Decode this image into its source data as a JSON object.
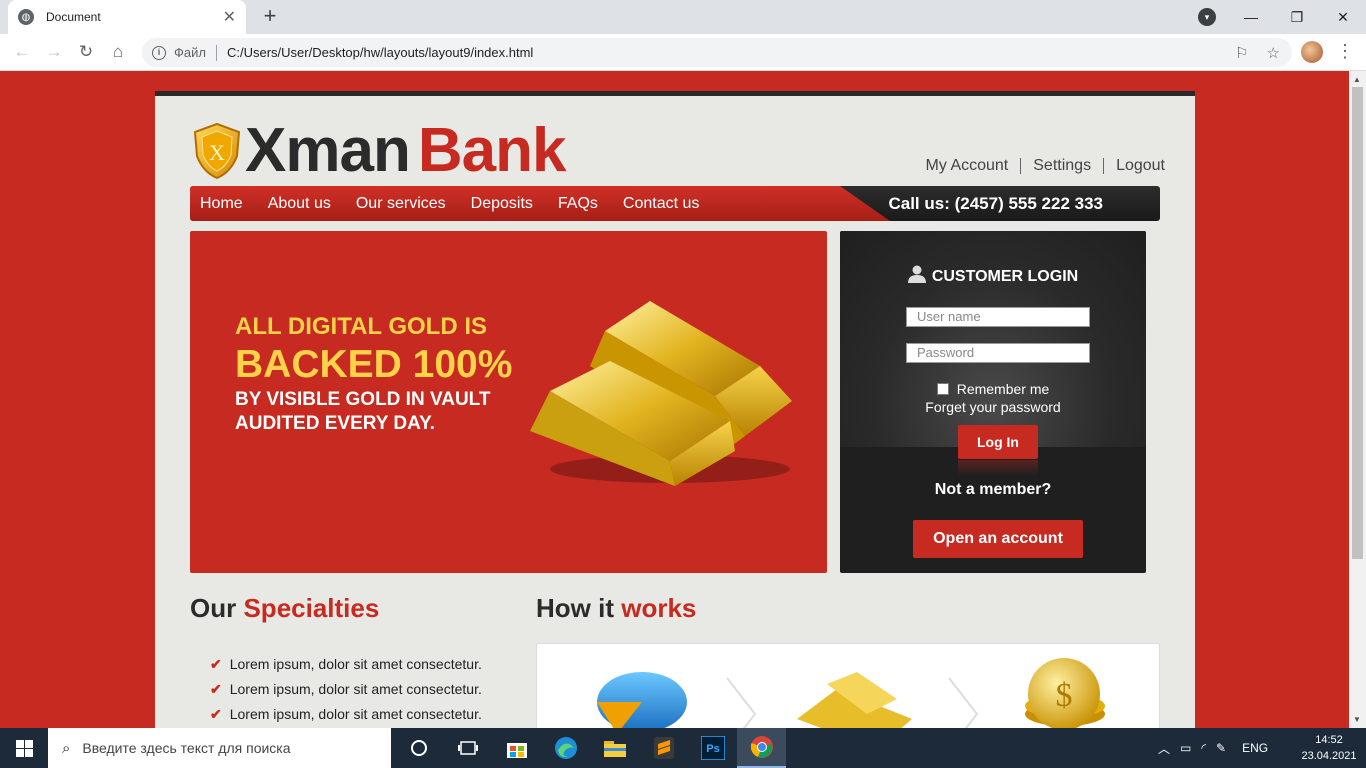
{
  "browser": {
    "tab_title": "Document",
    "address_file_label": "Файл",
    "address_url": "C:/Users/User/Desktop/hw/layouts/layout9/index.html"
  },
  "site": {
    "logo_part1": "Xman",
    "logo_part2": "Bank",
    "shield_letter": "X",
    "top_links": [
      "My Account",
      "Settings",
      "Logout"
    ],
    "nav": [
      "Home",
      "About us",
      "Our services",
      "Deposits",
      "FAQs",
      "Contact us"
    ],
    "call_us": "Call us: (2457) 555 222 333",
    "hero": {
      "line1": "ALL DIGITAL GOLD IS",
      "line2": "BACKED 100%",
      "line3": "BY VISIBLE GOLD IN VAULT",
      "line4": "AUDITED EVERY DAY."
    },
    "login": {
      "title": "CUSTOMER LOGIN",
      "username_placeholder": "User name",
      "password_placeholder": "Password",
      "remember": "Remember me",
      "forget": "Forget your password",
      "button": "Log In",
      "not_member": "Not a member?",
      "open_account": "Open an account"
    },
    "specialties": {
      "title_part1": "Our",
      "title_part2": "Specialties",
      "items": [
        "Lorem ipsum, dolor sit amet consectetur.",
        "Lorem ipsum, dolor sit amet consectetur.",
        "Lorem ipsum, dolor sit amet consectetur."
      ]
    },
    "how": {
      "title_part1": "How it",
      "title_part2": "works"
    }
  },
  "taskbar": {
    "search_placeholder": "Введите здесь текст для поиска",
    "lang": "ENG",
    "time": "14:52",
    "date": "23.04.2021"
  },
  "colors": {
    "brand_red": "#c62a20",
    "gold_text": "#ffd24a",
    "dark": "#2b2b2b"
  }
}
